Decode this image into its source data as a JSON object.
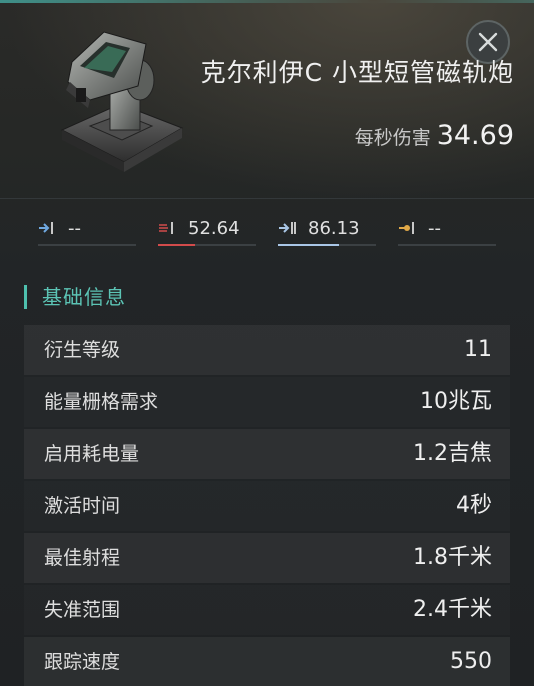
{
  "item": {
    "name": "克尔利伊C 小型短管磁轨炮",
    "dps_label": "每秒伤害",
    "dps_value": "34.69"
  },
  "damage": [
    {
      "type": "em",
      "icon": "em-damage-icon",
      "value": "--",
      "color": "#6fa8e0",
      "fill": 0
    },
    {
      "type": "thermal",
      "icon": "thermal-damage-icon",
      "value": "52.64",
      "color": "#d24b4b",
      "fill": 0.38
    },
    {
      "type": "kinetic",
      "icon": "kinetic-damage-icon",
      "value": "86.13",
      "color": "#a9c6e6",
      "fill": 0.62
    },
    {
      "type": "explosive",
      "icon": "explosive-damage-icon",
      "value": "--",
      "color": "#e0a848",
      "fill": 0
    }
  ],
  "section": {
    "title": "基础信息",
    "accent_color": "#4ec0ae"
  },
  "attributes": [
    {
      "label": "衍生等级",
      "value": "11"
    },
    {
      "label": "能量栅格需求",
      "value": "10兆瓦"
    },
    {
      "label": "启用耗电量",
      "value": "1.2吉焦"
    },
    {
      "label": "激活时间",
      "value": "4秒"
    },
    {
      "label": "最佳射程",
      "value": "1.8千米"
    },
    {
      "label": "失准范围",
      "value": "2.4千米"
    },
    {
      "label": "跟踪速度",
      "value": "550"
    }
  ]
}
